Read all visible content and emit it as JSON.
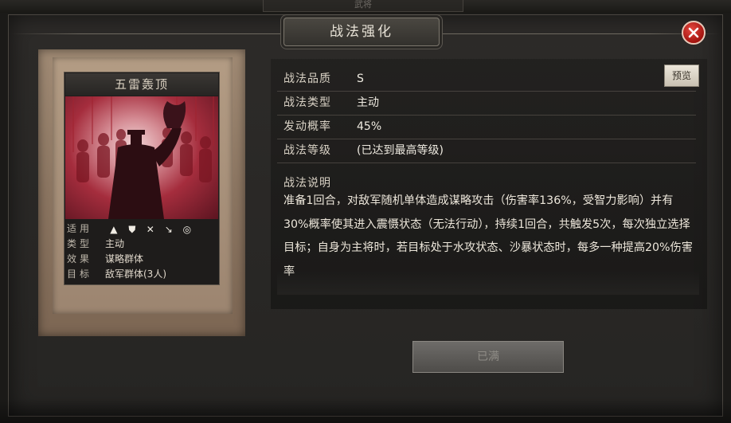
{
  "window": {
    "top_tab": "武将",
    "title": "战法强化"
  },
  "card": {
    "name": "五雷轰顶",
    "info": [
      {
        "key": "适用",
        "value": ""
      },
      {
        "key": "类型",
        "value": "主动"
      },
      {
        "key": "效果",
        "value": "谋略群体"
      },
      {
        "key": "目标",
        "value": "敌军群体(3人)"
      }
    ],
    "unit_icons": [
      "cavalry-icon",
      "shield-icon",
      "bow-icon",
      "spear-icon",
      "siege-icon"
    ],
    "art_colors": {
      "primary": "#a52d3d",
      "highlight": "#f2d7d8"
    }
  },
  "attributes": [
    {
      "key": "战法品质",
      "value": "S"
    },
    {
      "key": "战法类型",
      "value": "主动"
    },
    {
      "key": "发动概率",
      "value": "45%"
    },
    {
      "key": "战法等级",
      "value": "(已达到最高等级)"
    }
  ],
  "preview_button": "预览",
  "description": {
    "title": "战法说明",
    "text": "准备1回合，对敌军随机单体造成谋略攻击（伤害率136%，受智力影响）并有30%概率使其进入震慑状态（无法行动），持续1回合，共触发5次，每次独立选择目标；自身为主将时，若目标处于水攻状态、沙暴状态时，每多一种提高20%伤害率"
  },
  "action_button": "已满",
  "colors": {
    "close_button": "#c8241c",
    "text_main": "#ece6da",
    "panel_bg": "#2a2826"
  }
}
